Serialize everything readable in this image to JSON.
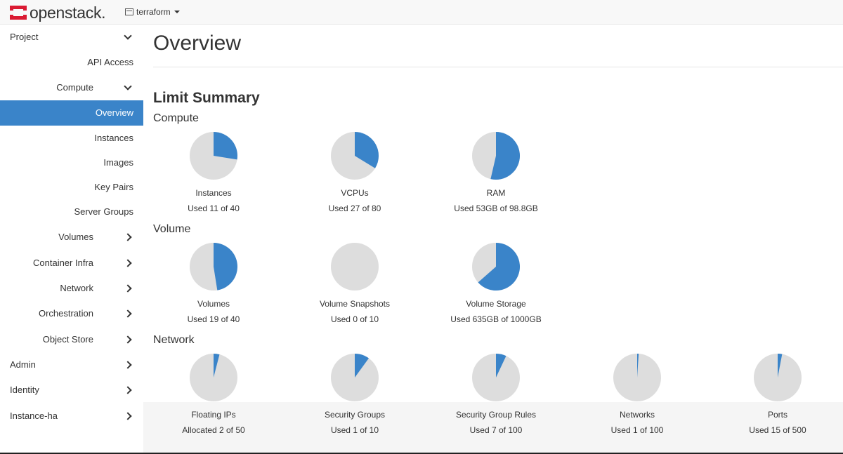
{
  "navbar": {
    "brand": "openstack.",
    "project": "terraform"
  },
  "sidebar": {
    "items": [
      {
        "label": "Project",
        "chevron": "down",
        "level": 0
      },
      {
        "label": "API Access",
        "level": 2
      },
      {
        "label": "Compute",
        "chevron": "down",
        "level": 1
      },
      {
        "label": "Overview",
        "level": 2,
        "active": true
      },
      {
        "label": "Instances",
        "level": 2
      },
      {
        "label": "Images",
        "level": 2
      },
      {
        "label": "Key Pairs",
        "level": 2
      },
      {
        "label": "Server Groups",
        "level": 2
      },
      {
        "label": "Volumes",
        "chevron": "right",
        "level": 1
      },
      {
        "label": "Container Infra",
        "chevron": "right",
        "level": 1
      },
      {
        "label": "Network",
        "chevron": "right",
        "level": 1
      },
      {
        "label": "Orchestration",
        "chevron": "right",
        "level": 1
      },
      {
        "label": "Object Store",
        "chevron": "right",
        "level": 1
      },
      {
        "label": "Admin",
        "chevron": "right",
        "level": 0
      },
      {
        "label": "Identity",
        "chevron": "right",
        "level": 0
      },
      {
        "label": "Instance-ha",
        "chevron": "right",
        "level": 0
      }
    ]
  },
  "main": {
    "title": "Overview",
    "limit_summary": "Limit Summary",
    "sections": [
      {
        "title": "Compute",
        "charts": [
          {
            "name": "Instances",
            "usage": "Used 11 of 40",
            "fraction": 0.275
          },
          {
            "name": "VCPUs",
            "usage": "Used 27 of 80",
            "fraction": 0.3375
          },
          {
            "name": "RAM",
            "usage": "Used 53GB of 98.8GB",
            "fraction": 0.536
          }
        ]
      },
      {
        "title": "Volume",
        "charts": [
          {
            "name": "Volumes",
            "usage": "Used 19 of 40",
            "fraction": 0.475
          },
          {
            "name": "Volume Snapshots",
            "usage": "Used 0 of 10",
            "fraction": 0.0
          },
          {
            "name": "Volume Storage",
            "usage": "Used 635GB of 1000GB",
            "fraction": 0.635
          }
        ]
      },
      {
        "title": "Network",
        "charts": [
          {
            "name": "Floating IPs",
            "usage": "Allocated 2 of 50",
            "fraction": 0.04
          },
          {
            "name": "Security Groups",
            "usage": "Used 1 of 10",
            "fraction": 0.1
          },
          {
            "name": "Security Group Rules",
            "usage": "Used 7 of 100",
            "fraction": 0.07
          },
          {
            "name": "Networks",
            "usage": "Used 1 of 100",
            "fraction": 0.01
          },
          {
            "name": "Ports",
            "usage": "Used 15 of 500",
            "fraction": 0.03
          }
        ]
      }
    ]
  },
  "colors": {
    "used": "#3a84c9",
    "free": "#dddddd",
    "active_bg": "#3a84c9",
    "brand_red": "#da1a32"
  }
}
